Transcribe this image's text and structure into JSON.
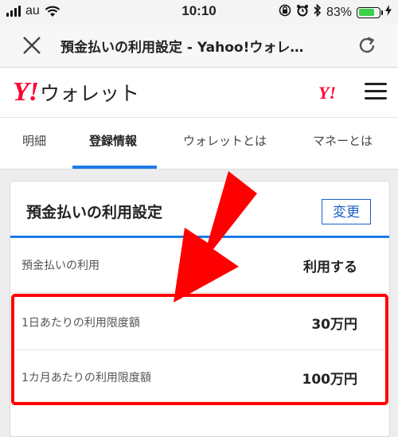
{
  "statusbar": {
    "carrier": "au",
    "time": "10:10",
    "battery": "83%",
    "battery_level": 0.83
  },
  "browser": {
    "title": "預金払いの利用設定 - Yahoo!ウォレ…"
  },
  "app": {
    "logo_mark": "Y!",
    "logo_text": "ウォレット",
    "small_logo": "Y!"
  },
  "tabs": [
    {
      "label": "明細"
    },
    {
      "label": "登録情報"
    },
    {
      "label": "ウォレットとは"
    },
    {
      "label": "マネーとは"
    }
  ],
  "card": {
    "title": "預金払いの利用設定",
    "edit_label": "変更",
    "rows": [
      {
        "label": "預金払いの利用",
        "value": "利用する"
      },
      {
        "label": "1日あたりの利用限度額",
        "value": "30万円"
      },
      {
        "label": "1カ月あたりの利用限度額",
        "value": "100万円"
      }
    ]
  },
  "colors": {
    "brand_red": "#ff0033",
    "accent_blue": "#1c7be8",
    "annotation_red": "#ff0000"
  }
}
